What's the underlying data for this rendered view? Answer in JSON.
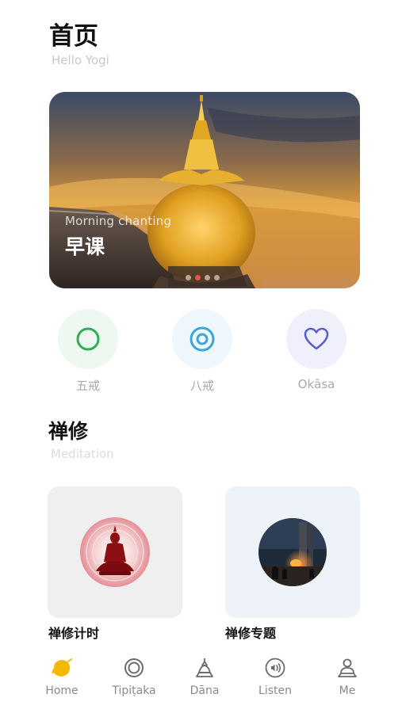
{
  "header": {
    "title": "首页",
    "subtitle": "Hello Yogi"
  },
  "banner": {
    "caption": "Morning chanting",
    "title": "早课",
    "slide_count": 4,
    "active_slide": 2
  },
  "quick_actions": [
    {
      "label": "五戒",
      "icon": "ring-icon",
      "color": "#2fae58"
    },
    {
      "label": "八戒",
      "icon": "double-ring-icon",
      "color": "#3ba6d4"
    },
    {
      "label": "Okāsa",
      "icon": "heart-icon",
      "color": "#5a5fd0"
    }
  ],
  "meditation": {
    "title": "禅修",
    "subtitle": "Meditation",
    "cards": [
      {
        "label": "禅修计时",
        "icon": "buddha-icon"
      },
      {
        "label": "禅修专题",
        "icon": "temple-photo"
      }
    ]
  },
  "tabbar": [
    {
      "label": "Home",
      "icon": "bell-leaf-icon",
      "active": true,
      "active_color": "#f5b800"
    },
    {
      "label": "Tipiṭaka",
      "icon": "ring-icon"
    },
    {
      "label": "Dāna",
      "icon": "stupa-icon"
    },
    {
      "label": "Listen",
      "icon": "audio-icon"
    },
    {
      "label": "Me",
      "icon": "monk-icon"
    }
  ]
}
